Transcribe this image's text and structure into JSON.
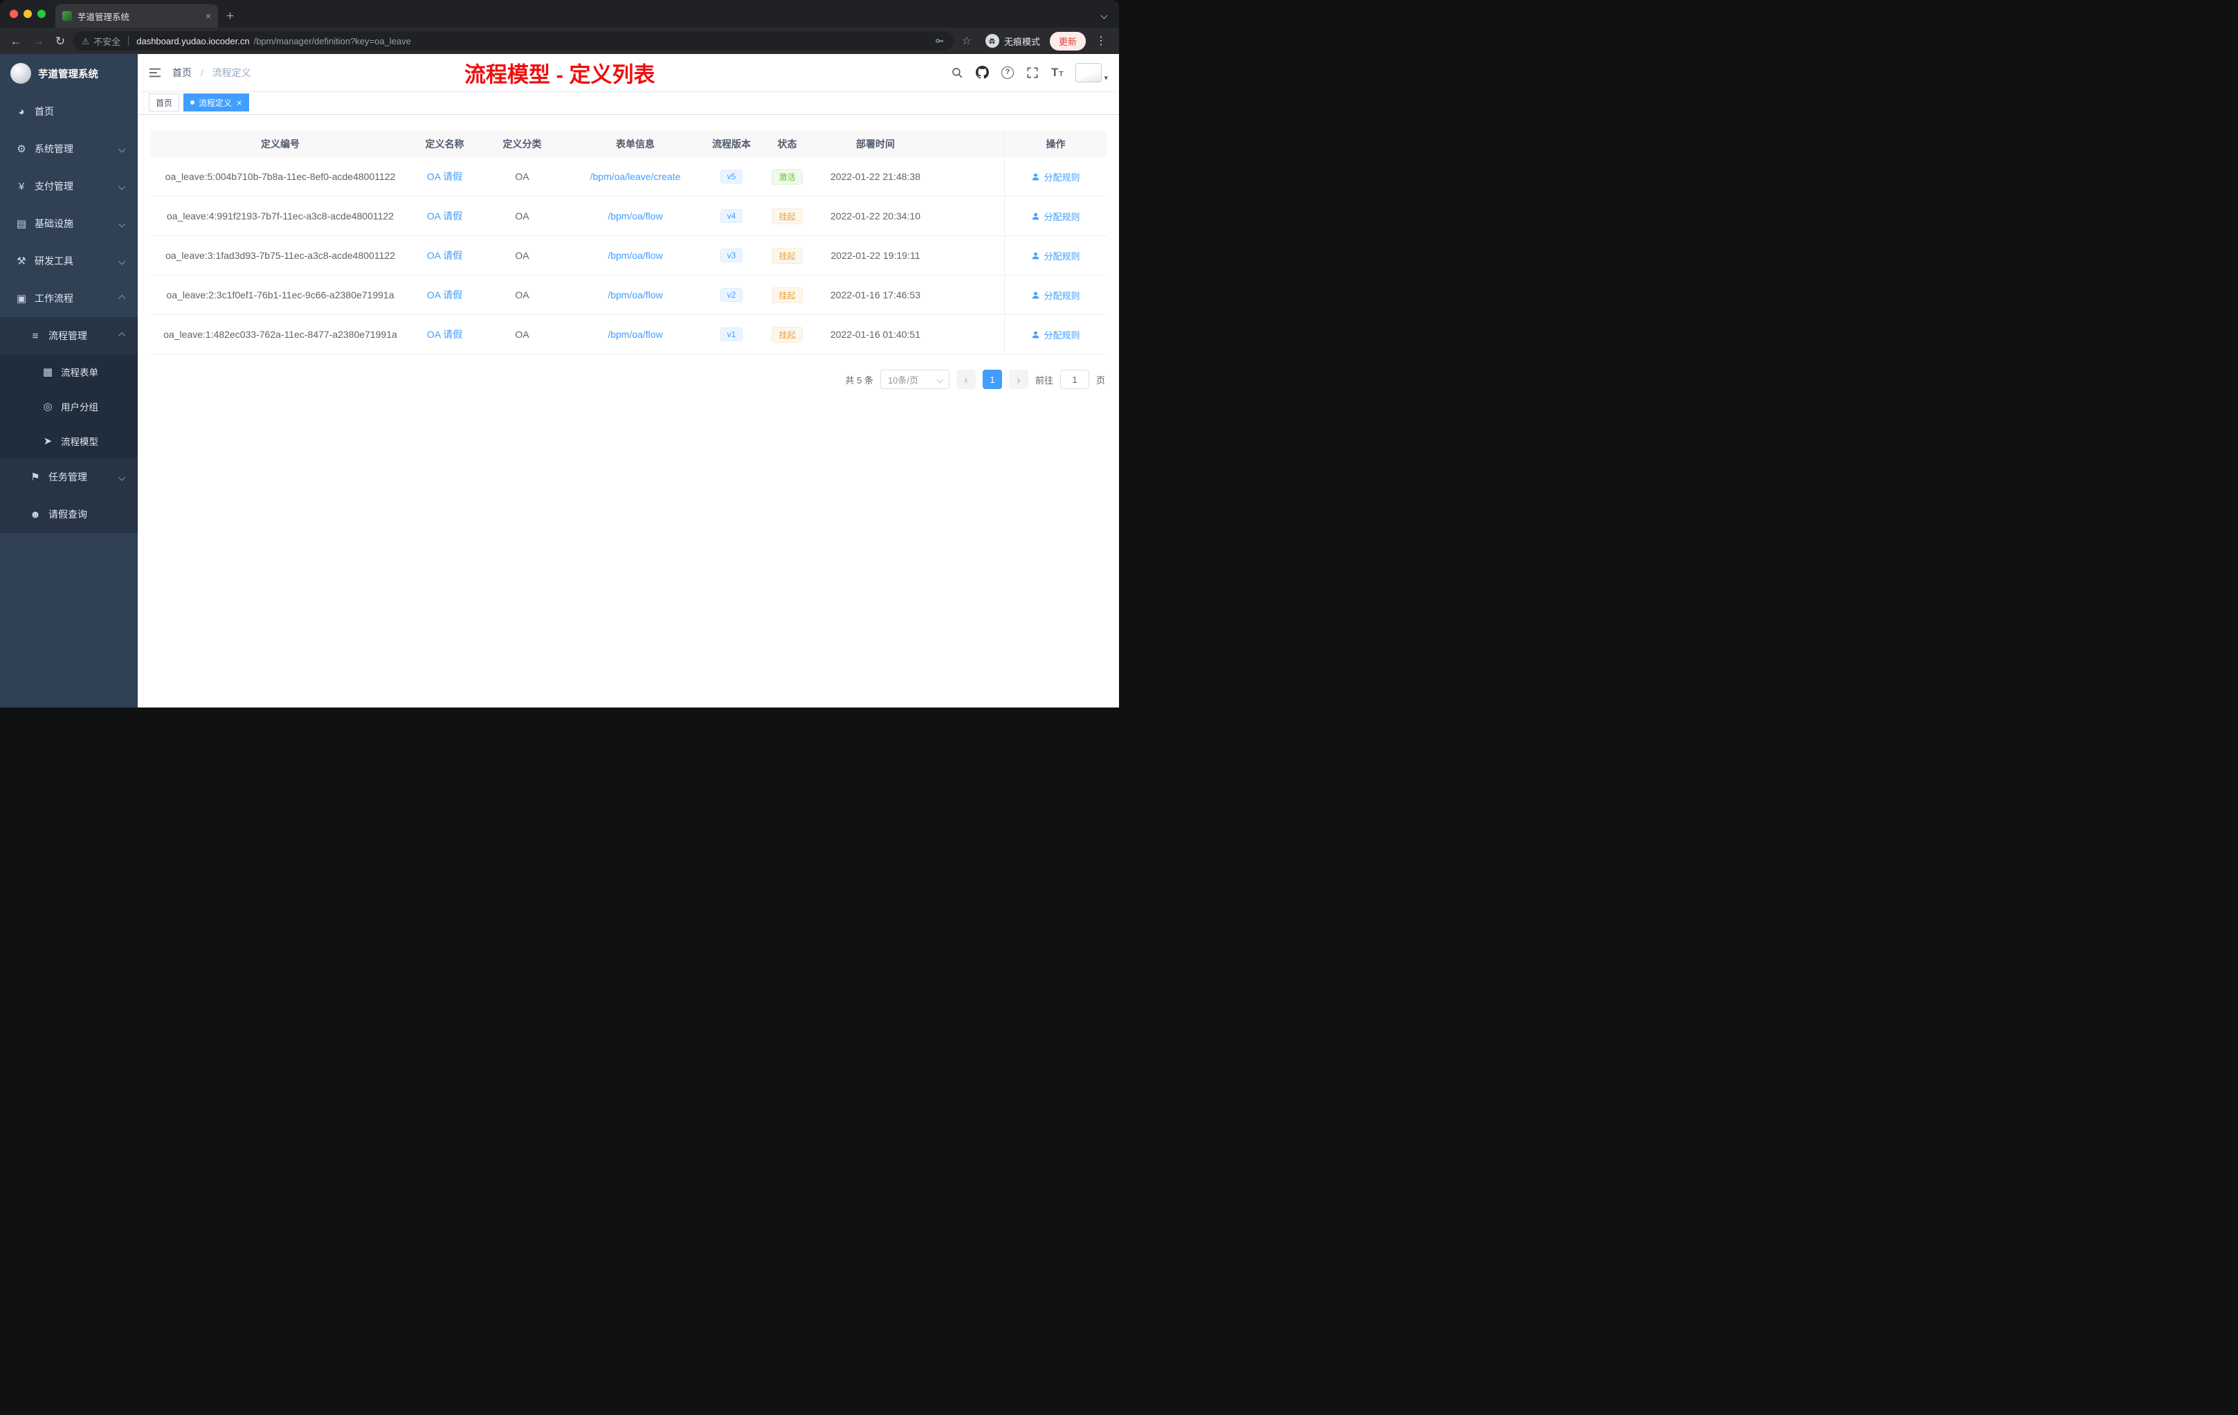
{
  "colors": {
    "accent": "#409eff",
    "success": "#67c23a",
    "warning": "#e6a23c",
    "annotation": "#f20d0d"
  },
  "glyphs": {
    "back-icon": "←",
    "forward-icon": "→",
    "reload-icon": "↻",
    "warning-icon": "⚠",
    "star-icon": "☆",
    "kebab-icon": "⋮",
    "plus-icon": "+",
    "close-icon": "×",
    "caret-down-icon": "▾",
    "question-icon": "?",
    "fontsize-icon": "T",
    "chevron-left-icon": "‹",
    "chevron-right-icon": "›",
    "dashboard-icon": "◕",
    "gear-icon": "⚙",
    "yen-icon": "¥",
    "infrastructure-icon": "▤",
    "tools-icon": "⚒",
    "workflow-icon": "▣",
    "process-icon": "≡",
    "form-icon": "▦",
    "usergroup-icon": "◎",
    "model-icon": "➤",
    "task-icon": "⚑",
    "person-icon": "☻"
  },
  "browser": {
    "tab_title": "芋道管理系统",
    "security_label": "不安全",
    "url_host": "dashboard.yudao.iocoder.cn",
    "url_path": "/bpm/manager/definition?key=oa_leave",
    "incognito_label": "无痕模式",
    "update_label": "更新"
  },
  "sidebar": {
    "title": "芋道管理系统",
    "menu": [
      {
        "key": "home",
        "label": "首页",
        "icon": "dashboard-icon",
        "level": 0
      },
      {
        "key": "system",
        "label": "系统管理",
        "icon": "gear-icon",
        "level": 0,
        "chevron": "down"
      },
      {
        "key": "payment",
        "label": "支付管理",
        "icon": "yen-icon",
        "level": 0,
        "chevron": "down"
      },
      {
        "key": "infrastructure",
        "label": "基础设施",
        "icon": "infrastructure-icon",
        "level": 0,
        "chevron": "down"
      },
      {
        "key": "dev-tools",
        "label": "研发工具",
        "icon": "tools-icon",
        "level": 0,
        "chevron": "down"
      },
      {
        "key": "workflow",
        "label": "工作流程",
        "icon": "workflow-icon",
        "level": 0,
        "chevron": "up"
      },
      {
        "key": "process-manage",
        "label": "流程管理",
        "icon": "process-icon",
        "level": 1,
        "chevron": "up"
      },
      {
        "key": "process-form",
        "label": "流程表单",
        "icon": "form-icon",
        "level": 2
      },
      {
        "key": "user-group",
        "label": "用户分组",
        "icon": "usergroup-icon",
        "level": 2
      },
      {
        "key": "process-model",
        "label": "流程模型",
        "icon": "model-icon",
        "level": 2
      },
      {
        "key": "task-manage",
        "label": "任务管理",
        "icon": "task-icon",
        "level": 1,
        "chevron": "down"
      },
      {
        "key": "leave-query",
        "label": "请假查询",
        "icon": "person-icon",
        "level": 1
      }
    ]
  },
  "header": {
    "breadcrumb_home": "首页",
    "breadcrumb_separator": "/",
    "breadcrumb_current": "流程定义",
    "annotation": "流程模型 - 定义列表"
  },
  "tags": [
    {
      "label": "首页",
      "active": false
    },
    {
      "label": "流程定义",
      "active": true
    }
  ],
  "table": {
    "columns": [
      "定义编号",
      "定义名称",
      "定义分类",
      "表单信息",
      "流程版本",
      "状态",
      "部署时间",
      "操作"
    ],
    "rows": [
      {
        "id": "oa_leave:5:004b710b-7b8a-11ec-8ef0-acde48001122",
        "name": "OA 请假",
        "category": "OA",
        "form": "/bpm/oa/leave/create",
        "version": "v5",
        "status": "激活",
        "status_type": "active",
        "time": "2022-01-22 21:48:38",
        "action": "分配规则"
      },
      {
        "id": "oa_leave:4:991f2193-7b7f-11ec-a3c8-acde48001122",
        "name": "OA 请假",
        "category": "OA",
        "form": "/bpm/oa/flow",
        "version": "v4",
        "status": "挂起",
        "status_type": "suspended",
        "time": "2022-01-22 20:34:10",
        "action": "分配规则"
      },
      {
        "id": "oa_leave:3:1fad3d93-7b75-11ec-a3c8-acde48001122",
        "name": "OA 请假",
        "category": "OA",
        "form": "/bpm/oa/flow",
        "version": "v3",
        "status": "挂起",
        "status_type": "suspended",
        "time": "2022-01-22 19:19:11",
        "action": "分配规则"
      },
      {
        "id": "oa_leave:2:3c1f0ef1-76b1-11ec-9c66-a2380e71991a",
        "name": "OA 请假",
        "category": "OA",
        "form": "/bpm/oa/flow",
        "version": "v2",
        "status": "挂起",
        "status_type": "suspended",
        "time": "2022-01-16 17:46:53",
        "action": "分配规则"
      },
      {
        "id": "oa_leave:1:482ec033-762a-11ec-8477-a2380e71991a",
        "name": "OA 请假",
        "category": "OA",
        "form": "/bpm/oa/flow",
        "version": "v1",
        "status": "挂起",
        "status_type": "suspended",
        "time": "2022-01-16 01:40:51",
        "action": "分配规则"
      }
    ]
  },
  "pagination": {
    "total": "共 5 条",
    "page_size": "10条/页",
    "current_page": "1",
    "goto_prefix": "前往",
    "goto_value": "1",
    "goto_suffix": "页"
  }
}
